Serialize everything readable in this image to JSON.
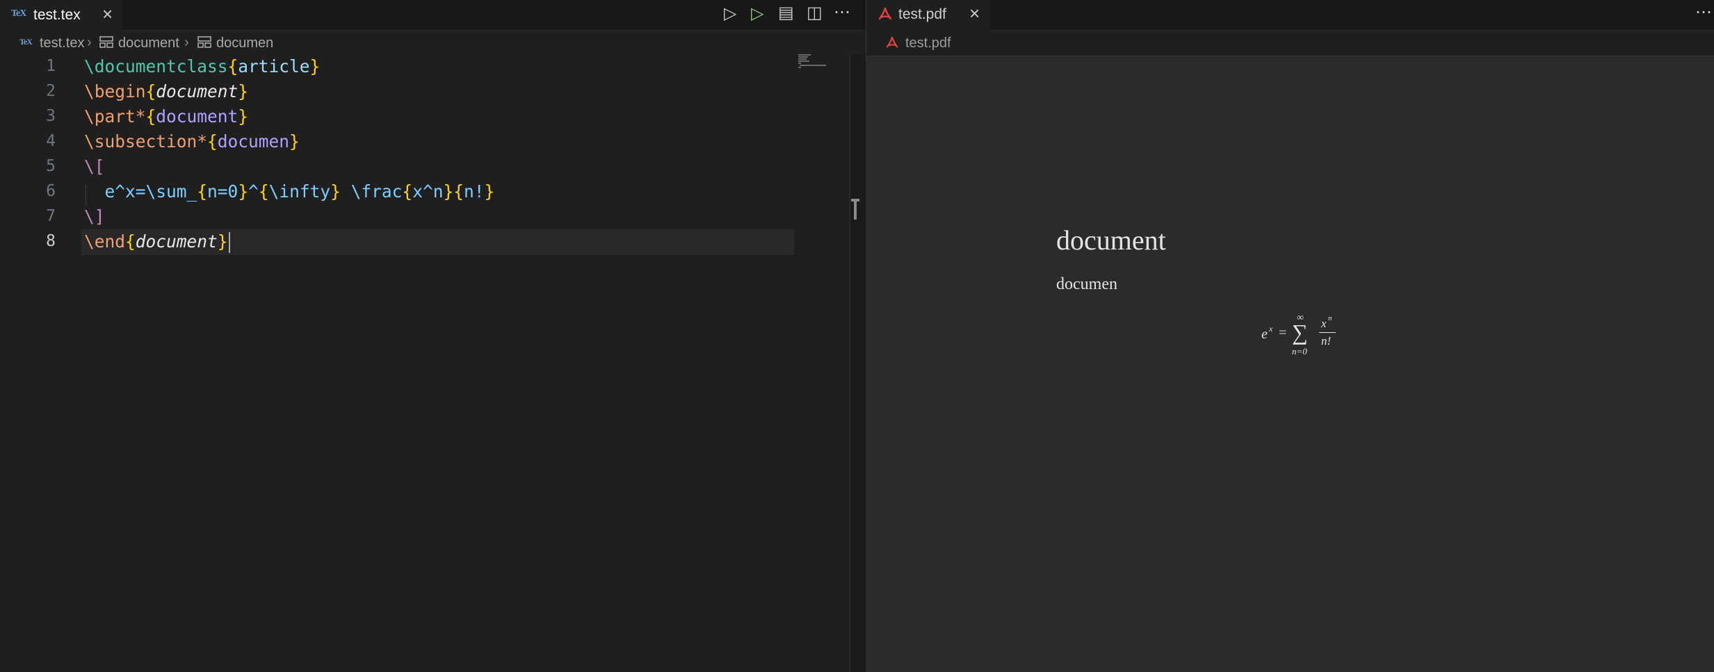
{
  "editor": {
    "tab": {
      "logo": "TeX",
      "label": "test.tex",
      "close": "×"
    },
    "toolbar": {
      "run_icon": "▷",
      "debug_icon": "▷",
      "preview_icon": "▤",
      "split_icon": "◫",
      "more_icon": "⋯"
    },
    "breadcrumb": {
      "file": "test.tex",
      "sep1": "›",
      "item1": "document",
      "sep2": "›",
      "item2": "documen"
    },
    "line_numbers": [
      "1",
      "2",
      "3",
      "4",
      "5",
      "6",
      "7",
      "8"
    ],
    "active_line": "8",
    "code": {
      "l1_cmd": "\\documentclass",
      "l1_ob": "{",
      "l1_arg": "article",
      "l1_cb": "}",
      "l2_cmd": "\\begin",
      "l2_ob": "{",
      "l2_arg": "document",
      "l2_cb": "}",
      "l3_cmd": "\\part*",
      "l3_ob": "{",
      "l3_arg": "document",
      "l3_cb": "}",
      "l4_cmd": "\\subsection*",
      "l4_ob": "{",
      "l4_arg": "documen",
      "l4_cb": "}",
      "l5": "\\[",
      "l6_a": "  e^x=",
      "l6_b": "\\sum_",
      "l6_c": "{",
      "l6_d": "n=0",
      "l6_e": "}",
      "l6_f": "^",
      "l6_g": "{",
      "l6_h": "\\infty",
      "l6_i": "}",
      "l6_j": " ",
      "l6_k": "\\frac",
      "l6_l": "{",
      "l6_m": "x^n",
      "l6_n": "}",
      "l6_o": "{",
      "l6_p": "n!",
      "l6_q": "}",
      "l7": "\\]",
      "l8_cmd": "\\end",
      "l8_ob": "{",
      "l8_arg": "document",
      "l8_cb": "}"
    },
    "sash_icon": "T"
  },
  "pdf_viewer": {
    "tab": {
      "label": "test.pdf",
      "close": "×",
      "icon": "pdf-icon"
    },
    "more_icon": "⋯",
    "breadcrumb": {
      "file": "test.pdf"
    },
    "rendered": {
      "part_title": "document",
      "subsection_title": "documen",
      "eq_lhs_base": "e",
      "eq_lhs_sup": "x",
      "eq_equals": "=",
      "eq_sum_top": "∞",
      "eq_sum_symbol": "∑",
      "eq_sum_bottom": "n=0",
      "eq_frac_num_base": "x",
      "eq_frac_num_sup": "n",
      "eq_frac_den": "n!"
    }
  },
  "colors": {
    "editor_bg": "#1f1f1f",
    "tabbar_bg": "#181818",
    "pdf_bg": "#2b2b2b",
    "command": "#4ec9b0",
    "brace": "#ffd700",
    "pdf_icon": "#e04444"
  }
}
